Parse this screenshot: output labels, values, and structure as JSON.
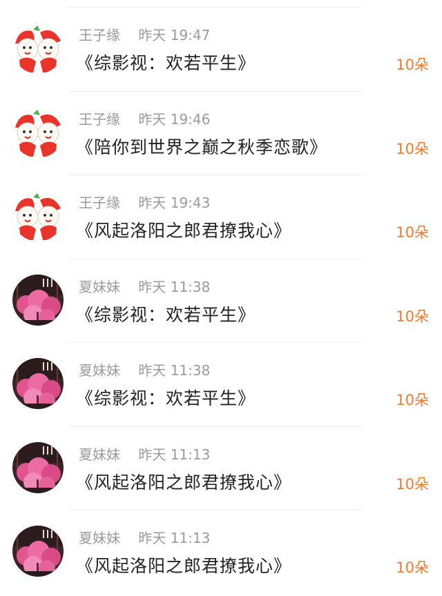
{
  "gifts": [
    {
      "user": "王子缘",
      "time": "昨天 19:47",
      "title": "《综影视：欢若平生》",
      "count": "10朵",
      "avatar": "strawberry-kids-avatar"
    },
    {
      "user": "王子缘",
      "time": "昨天 19:46",
      "title": "《陪你到世界之巅之秋季恋歌》",
      "count": "10朵",
      "avatar": "strawberry-kids-avatar"
    },
    {
      "user": "王子缘",
      "time": "昨天 19:43",
      "title": "《风起洛阳之郎君撩我心》",
      "count": "10朵",
      "avatar": "strawberry-kids-avatar"
    },
    {
      "user": "夏妹妹",
      "time": "昨天 11:38",
      "title": "《综影视：欢若平生》",
      "count": "10朵",
      "avatar": "pink-blossom-avatar"
    },
    {
      "user": "夏妹妹",
      "time": "昨天 11:38",
      "title": "《综影视：欢若平生》",
      "count": "10朵",
      "avatar": "pink-blossom-avatar"
    },
    {
      "user": "夏妹妹",
      "time": "昨天 11:13",
      "title": "《风起洛阳之郎君撩我心》",
      "count": "10朵",
      "avatar": "pink-blossom-avatar"
    },
    {
      "user": "夏妹妹",
      "time": "昨天 11:13",
      "title": "《风起洛阳之郎君撩我心》",
      "count": "10朵",
      "avatar": "pink-blossom-avatar"
    }
  ],
  "colors": {
    "count_accent": "#f07a2e",
    "meta_gray": "#9a9a9a",
    "title_text": "#222222",
    "divider": "#eeeeee"
  }
}
